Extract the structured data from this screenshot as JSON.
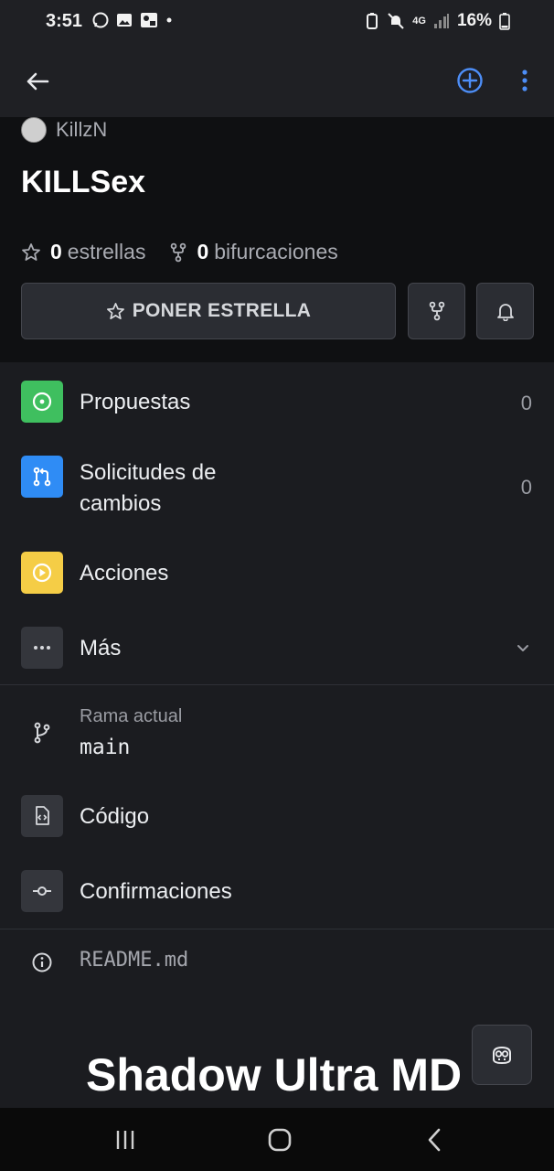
{
  "status_bar": {
    "time": "3:51",
    "network": "4G",
    "battery": "16%"
  },
  "repo": {
    "owner": "KillzN",
    "name": "KILLSex"
  },
  "stats": {
    "stars_count": "0",
    "stars_label": "estrellas",
    "forks_count": "0",
    "forks_label": "bifurcaciones"
  },
  "actions": {
    "star_label": "PONER ESTRELLA"
  },
  "menu": {
    "issues": {
      "label": "Propuestas",
      "count": "0"
    },
    "pulls": {
      "label_line1": "Solicitudes de",
      "label_line2": "cambios",
      "count": "0"
    },
    "actions": {
      "label": "Acciones"
    },
    "more": {
      "label": "Más"
    }
  },
  "branch": {
    "caption": "Rama actual",
    "value": "main"
  },
  "code": {
    "label": "Código"
  },
  "commits": {
    "label": "Confirmaciones"
  },
  "readme": {
    "label": "README.md"
  },
  "watermark": "Shadow Ultra MD",
  "colors": {
    "issues_tile": "#3fbf5f",
    "pulls_tile": "#2f8cf5",
    "actions_tile": "#f5cd46",
    "accent": "#4d8ef7"
  }
}
